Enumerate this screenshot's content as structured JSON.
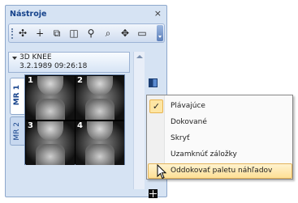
{
  "panel": {
    "title": "Nástroje",
    "close_glyph": "×",
    "toolbar": [
      {
        "icon": "move-pan-icon",
        "glyph": "✣"
      },
      {
        "icon": "window-level-icon",
        "glyph": "∔"
      },
      {
        "icon": "copy-icon",
        "glyph": "⧉"
      },
      {
        "icon": "compare-icon",
        "glyph": "◫"
      },
      {
        "icon": "zoom-icon",
        "glyph": "⚲"
      },
      {
        "icon": "zoom-region-icon",
        "glyph": "⌕"
      },
      {
        "icon": "crosshair-icon",
        "glyph": "✥"
      },
      {
        "icon": "overlay-icon",
        "glyph": "▭"
      }
    ]
  },
  "study": {
    "name": "3D KNEE",
    "date": "3.2.1989 09:26:18"
  },
  "tabs": [
    {
      "label": "MR 1",
      "active": true
    },
    {
      "label": "MR 2",
      "active": false
    }
  ],
  "thumbnails": [
    "1",
    "2",
    "3",
    "4"
  ],
  "menu": {
    "items": [
      {
        "label": "Plávajúce",
        "checked": true,
        "check_glyph": "✓"
      },
      {
        "label": "Dokované",
        "checked": false
      },
      {
        "label": "Skryť",
        "checked": false
      },
      {
        "label": "Uzamknúť záložky",
        "checked": false
      },
      {
        "label": "Oddokovať paletu náhľadov",
        "checked": false,
        "highlighted": true
      }
    ]
  },
  "colors": {
    "panel_bg": "#d6e3f3",
    "title_text": "#15428b",
    "menu_highlight": "#fddf95",
    "check_bg": "#fde5a3"
  }
}
